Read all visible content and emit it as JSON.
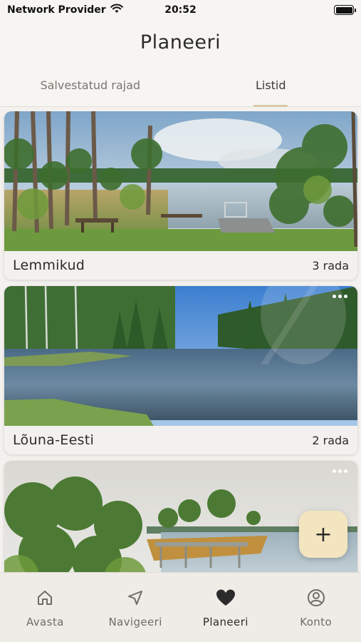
{
  "status_bar": {
    "carrier": "Network Provider",
    "time": "20:52",
    "wifi_icon": "wifi-icon",
    "battery_icon": "battery-icon"
  },
  "header": {
    "title": "Planeeri",
    "tabs": [
      {
        "label": "Salvestatud rajad",
        "active": false
      },
      {
        "label": "Listid",
        "active": true
      }
    ]
  },
  "lists": [
    {
      "name": "Lemmikud",
      "count": "3 rada",
      "image": "lake-with-bench-and-pier",
      "has_menu": false
    },
    {
      "name": "Lõuna-Eesti",
      "count": "2 rada",
      "image": "forest-river-reflection",
      "has_menu": true
    },
    {
      "name": "",
      "count": "",
      "image": "bog-lake-with-boardwalk",
      "has_menu": true
    }
  ],
  "fab": {
    "label": "+",
    "icon": "plus-icon"
  },
  "tabbar": {
    "items": [
      {
        "label": "Avasta",
        "icon": "home-icon",
        "active": false
      },
      {
        "label": "Navigeeri",
        "icon": "navigation-arrow-icon",
        "active": false
      },
      {
        "label": "Planeeri",
        "icon": "heart-icon",
        "active": true
      },
      {
        "label": "Konto",
        "icon": "user-circle-icon",
        "active": false
      }
    ]
  },
  "colors": {
    "background": "#f4f1ee",
    "accent": "#d9c9a8",
    "fab": "#f3e5bf",
    "text": "#2b2b2b"
  }
}
